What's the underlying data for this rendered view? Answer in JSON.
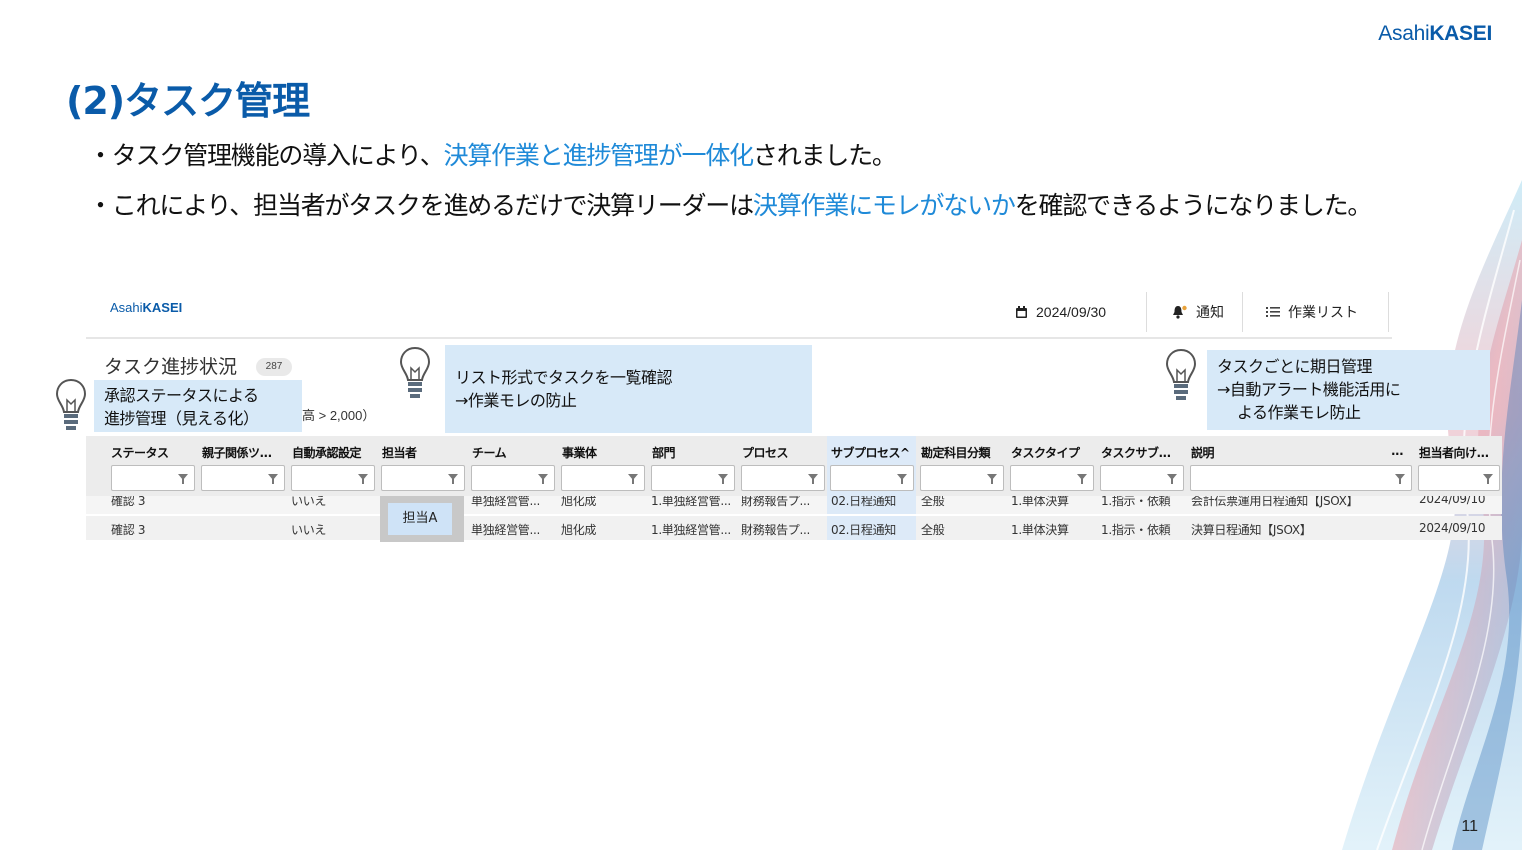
{
  "slide": {
    "logo_light": "Asahi",
    "logo_bold": "KASEI",
    "title": "(2)タスク管理",
    "bullet1": {
      "prefix": "・タスク管理機能の導入により、",
      "highlight": "決算作業と進捗管理が一体化",
      "suffix": "されました。"
    },
    "bullet2": {
      "prefix": "・これにより、担当者がタスクを進めるだけで決算リーダーは",
      "highlight": "決算作業にモレがないか",
      "suffix": "を確認できるようになりました。"
    },
    "page_number": "11",
    "accent_color": "#0a5ba9",
    "highlight_color": "#1f8ad8"
  },
  "app": {
    "logo_light": "Asahi",
    "logo_bold": "KASEI",
    "date": "2024/09/30",
    "notify_label": "通知",
    "worklist_label": "作業リスト",
    "task_title": "タスク進捗状況",
    "task_count": "287",
    "partial_text": "高 > 2,000）"
  },
  "callouts": {
    "left_line1": "承認ステータスによる",
    "left_line2": "進捗管理（見える化）",
    "middle_line1": "リスト形式でタスクを一覧確認",
    "middle_line2": "→作業モレの防止",
    "right_line1": "タスクごとに期日管理",
    "right_line2": "→自動アラート機能活用に",
    "right_line3": "よる作業モレ防止"
  },
  "table": {
    "columns": [
      "ステータス",
      "親子関係ツ...",
      "自動承認設定",
      "担当者",
      "チーム",
      "事業体",
      "部門",
      "プロセス",
      "サブプロセス^",
      "勘定科目分類",
      "タスクタイプ",
      "タスクサブ...",
      "説明",
      "...",
      "担当者向け..."
    ],
    "rows": [
      [
        "確認 3",
        "",
        "いいえ",
        "",
        "単独経営管...",
        "旭化成",
        "1.単独経営管...",
        "財務報告プ...",
        "02.日程通知",
        "全般",
        "1.単体決算",
        "1.指示・依頼",
        "会計伝票運用日程通知【JSOX】",
        "",
        "2024/09/10"
      ],
      [
        "確認 3",
        "",
        "いいえ",
        "",
        "単独経営管...",
        "旭化成",
        "1.単独経営管...",
        "財務報告プ...",
        "02.日程通知",
        "全般",
        "1.単体決算",
        "1.指示・依頼",
        "決算日程通知【JSOX】",
        "",
        "2024/09/10"
      ]
    ],
    "assignee_tag": "担当A"
  }
}
